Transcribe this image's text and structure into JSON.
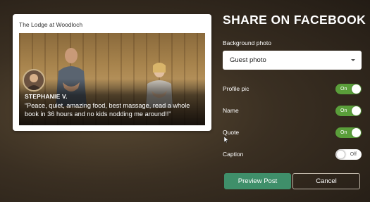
{
  "preview": {
    "business_name": "The Lodge at Woodloch",
    "reviewer_name": "STEPHANIE V.",
    "quote": "“Peace, quiet, amazing food, best massage, read a whole book in 36 hours and no kids nodding me around!!”"
  },
  "panel": {
    "title": "SHARE ON FACEBOOK",
    "background_photo_label": "Background photo",
    "background_photo_value": "Guest photo",
    "toggles": [
      {
        "label": "Profile pic",
        "state": "On"
      },
      {
        "label": "Name",
        "state": "On"
      },
      {
        "label": "Quote",
        "state": "On"
      },
      {
        "label": "Caption",
        "state": "Off"
      }
    ],
    "preview_button": "Preview Post",
    "cancel_button": "Cancel"
  },
  "colors": {
    "toggle_on": "#5a9e3a",
    "preview_button": "#3f8f6a"
  }
}
